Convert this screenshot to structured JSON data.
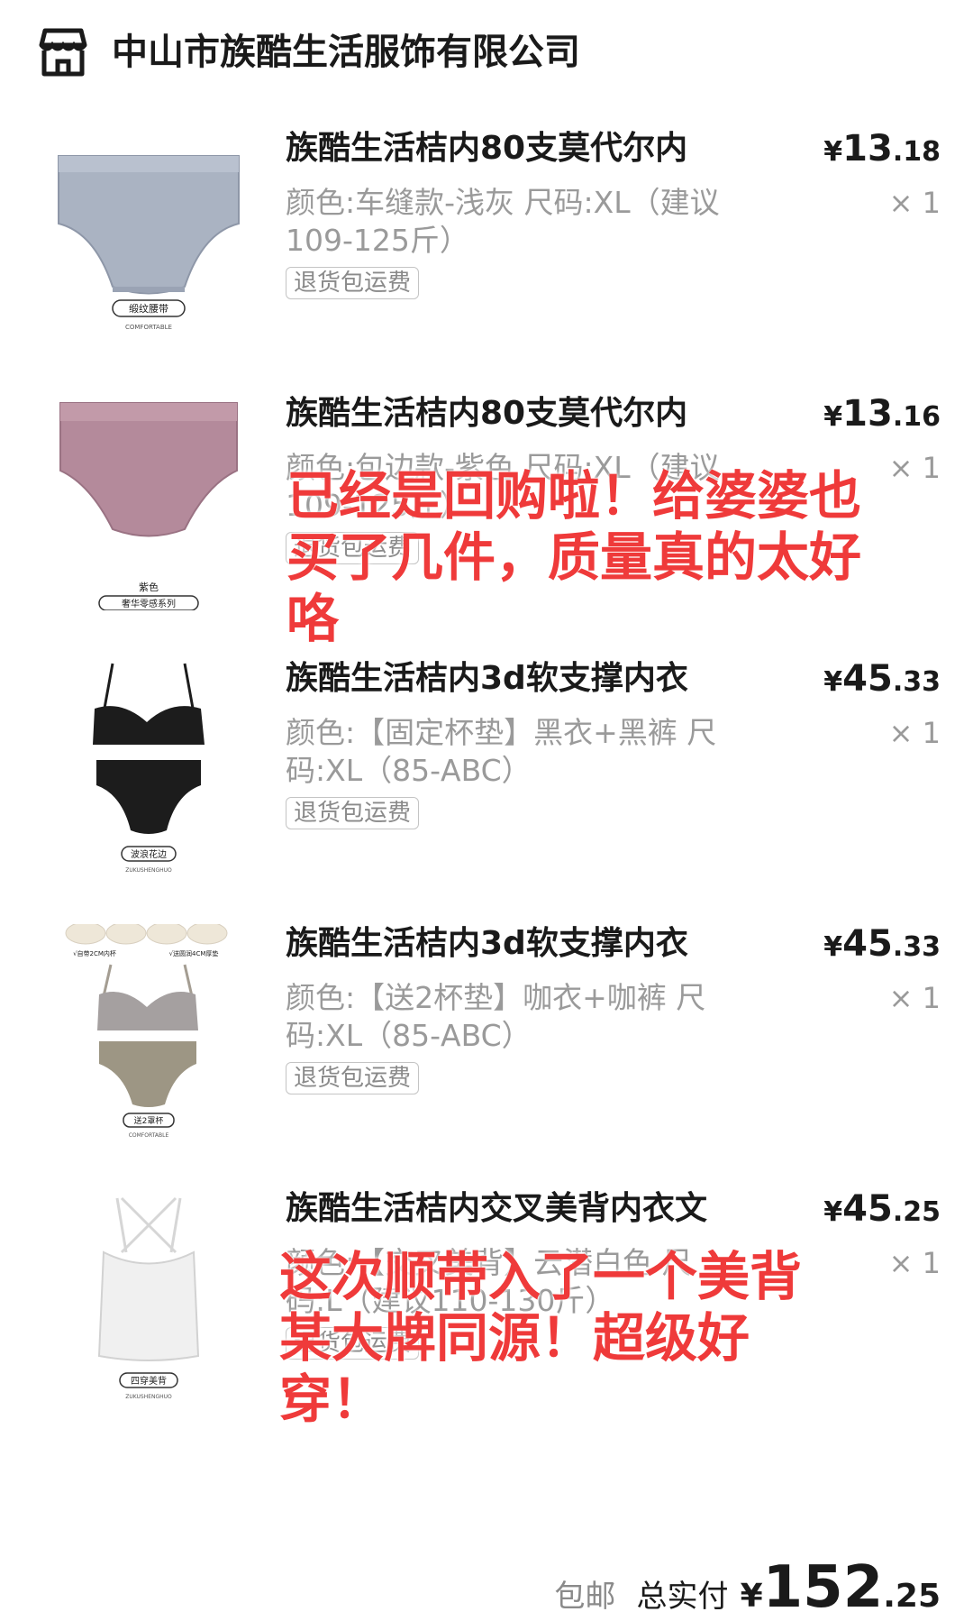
{
  "store": {
    "name": "中山市族酷生活服饰有限公司",
    "icon": "store-icon"
  },
  "items": [
    {
      "title": "族酷生活桔内80支莫代尔内",
      "price_currency": "¥",
      "price_int": "13",
      "price_dec": ".18",
      "spec": "颜色:车缝款-浅灰 尺码:XL（建议109-125斤）",
      "qty": "× 1",
      "tag": "退货包运费",
      "thumb_caption": "缎纹腰带",
      "thumb_sub": "COMFORTABLE",
      "color": "#aeb6c4"
    },
    {
      "title": "族酷生活桔内80支莫代尔内",
      "price_currency": "¥",
      "price_int": "13",
      "price_dec": ".16",
      "spec": "颜色:包边款-紫色 尺码:XL（建议109-125斤）",
      "qty": "× 1",
      "tag": "退货包运费",
      "thumb_caption": "奢华零感系列",
      "thumb_top": "紫色",
      "color": "#b88a9c"
    },
    {
      "title": "族酷生活桔内3d软支撑内衣",
      "price_currency": "¥",
      "price_int": "45",
      "price_dec": ".33",
      "spec": "颜色:【固定杯垫】黑衣+黑裤 尺码:XL（85-ABC）",
      "qty": "× 1",
      "tag": "退货包运费",
      "thumb_caption": "波浪花边",
      "thumb_sub": "ZUKUSHENGHUO",
      "color": "#1c1c1c"
    },
    {
      "title": "族酷生活桔内3d软支撑内衣",
      "price_currency": "¥",
      "price_int": "45",
      "price_dec": ".33",
      "spec": "颜色:【送2杯垫】咖衣+咖裤 尺码:XL（85-ABC）",
      "qty": "× 1",
      "tag": "退货包运费",
      "thumb_caption": "送2罩杯",
      "thumb_sub": "COMFORTABLE",
      "thumb_note1": "√自带2CM内杯",
      "thumb_note2": "√送圆润4CM厚垫",
      "color": "#a49d92"
    },
    {
      "title": "族酷生活桔内交叉美背内衣文",
      "price_currency": "¥",
      "price_int": "45",
      "price_dec": ".25",
      "spec": "颜色:【交叉美背】云潜白色 尺码:L（建议110-130斤）",
      "qty": "× 1",
      "tag": "退货包运费",
      "thumb_caption": "四穿美背",
      "thumb_sub": "ZUKUSHENGHUO",
      "color": "#eeeeee"
    }
  ],
  "overlays": [
    {
      "text": "已经是回购啦！给婆婆也买了几件，质量真的太好咯"
    },
    {
      "text": "这次顺带入了一个美背某大牌同源！超级好穿！"
    }
  ],
  "footer": {
    "shipping": "包邮",
    "total_label": "总实付",
    "total_currency": "¥",
    "total_int": "152",
    "total_dec": ".25"
  }
}
